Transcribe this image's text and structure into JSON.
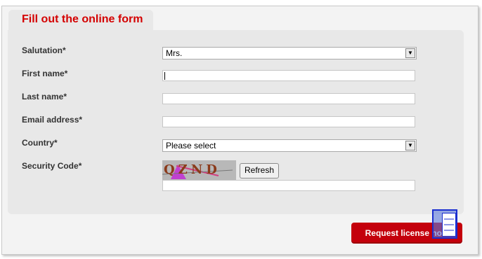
{
  "form": {
    "title": "Fill out the online form",
    "labels": {
      "salutation": "Salutation*",
      "first_name": "First name*",
      "last_name": "Last name*",
      "email": "Email address*",
      "country": "Country*",
      "security_code": "Security Code*"
    },
    "salutation_value": "Mrs.",
    "country_value": "Please select",
    "captcha_text": "QZND",
    "refresh_label": "Refresh",
    "submit_label": "Request license now"
  },
  "colors": {
    "accent": "#d40000",
    "button": "#c4000c",
    "panel": "#e8e8e8"
  },
  "icons": [
    "chevron-down-icon",
    "notepad-icon"
  ]
}
